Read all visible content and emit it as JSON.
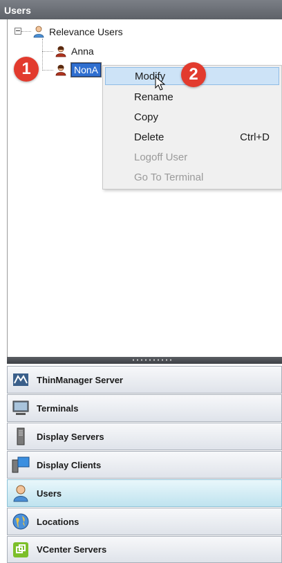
{
  "header": {
    "title": "Users"
  },
  "tree": {
    "root_label": "Relevance Users",
    "children": [
      {
        "label": "Anna"
      },
      {
        "label": "NonA"
      }
    ]
  },
  "context_menu": {
    "items": [
      {
        "label": "Modify",
        "shortcut": "",
        "state": "hover"
      },
      {
        "label": "Rename",
        "shortcut": "",
        "state": "enabled"
      },
      {
        "label": "Copy",
        "shortcut": "",
        "state": "enabled"
      },
      {
        "label": "Delete",
        "shortcut": "Ctrl+D",
        "state": "enabled"
      },
      {
        "label": "Logoff User",
        "shortcut": "",
        "state": "disabled"
      },
      {
        "label": "Go To Terminal",
        "shortcut": "",
        "state": "disabled"
      }
    ]
  },
  "annotations": {
    "badge_1": "1",
    "badge_2": "2"
  },
  "nav": {
    "active": "Users",
    "items": [
      {
        "label": "ThinManager Server",
        "icon": "thinmanager-server-icon"
      },
      {
        "label": "Terminals",
        "icon": "terminal-icon"
      },
      {
        "label": "Display Servers",
        "icon": "display-server-icon"
      },
      {
        "label": "Display Clients",
        "icon": "display-client-icon"
      },
      {
        "label": "Users",
        "icon": "user-icon"
      },
      {
        "label": "Locations",
        "icon": "globe-icon"
      },
      {
        "label": "VCenter Servers",
        "icon": "vcenter-icon"
      }
    ]
  },
  "colors": {
    "header_bg": "#6a6e75",
    "selection": "#2f6fd0",
    "badge": "#e23b2e",
    "menu_hover": "#cde3f7",
    "nav_active": "#bfe3ef"
  }
}
